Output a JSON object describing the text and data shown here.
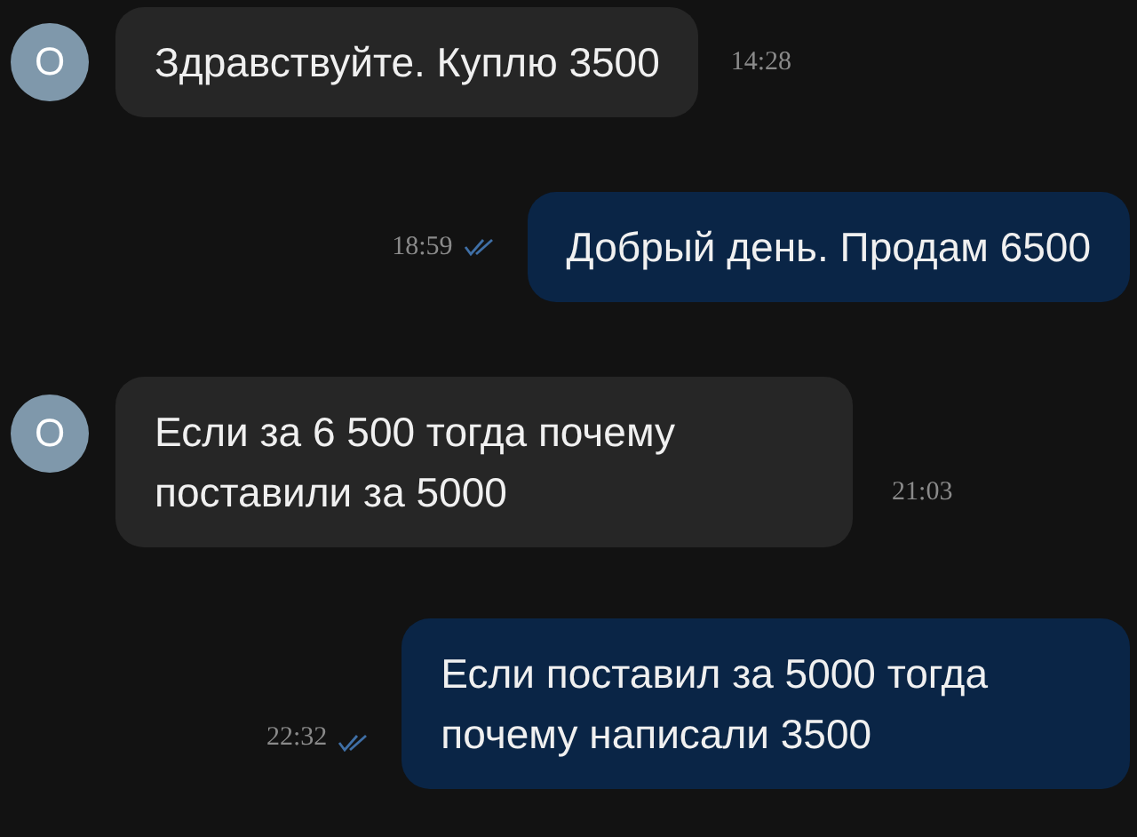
{
  "messages": [
    {
      "kind": "incoming",
      "avatar": "О",
      "text": "Здравствуйте. Куплю 3500",
      "time": "14:28"
    },
    {
      "kind": "outgoing",
      "text": "Добрый день. Продам 6500",
      "time": "18:59",
      "read": true
    },
    {
      "kind": "incoming",
      "avatar": "О",
      "text": "Если за 6 500 тогда почему\nпоставили за 5000",
      "time": "21:03"
    },
    {
      "kind": "outgoing",
      "text": "Если поставил за 5000 тогда\nпочему написали 3500",
      "time": "22:32",
      "read": true
    }
  ]
}
